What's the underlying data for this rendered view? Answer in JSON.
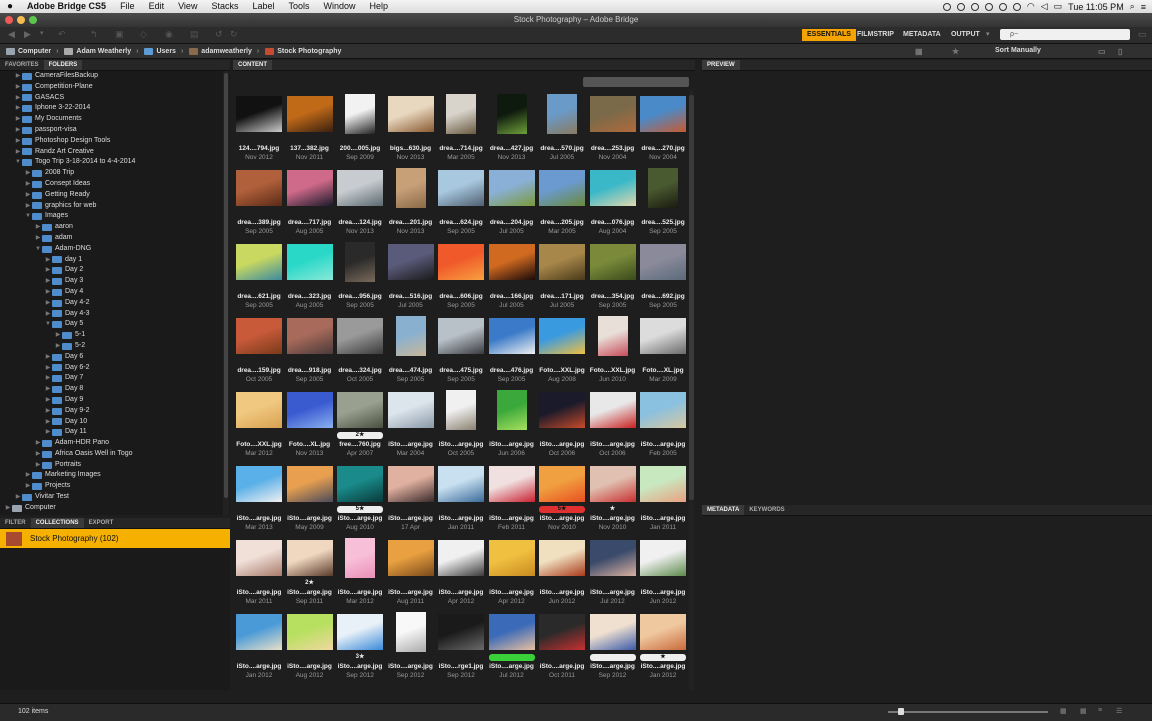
{
  "menubar": {
    "app_name": "Adobe Bridge CS5",
    "items": [
      "File",
      "Edit",
      "View",
      "Stacks",
      "Label",
      "Tools",
      "Window",
      "Help"
    ],
    "clock": "Tue 11:05 PM"
  },
  "window": {
    "title": "Stock Photography – Adobe Bridge"
  },
  "workspaces": {
    "essentials": "ESSENTIALS",
    "filmstrip": "FILMSTRIP",
    "metadata": "METADATA",
    "output": "OUTPUT"
  },
  "sort": {
    "label": "Sort Manually"
  },
  "search": {
    "placeholder": "ρ−"
  },
  "breadcrumb": [
    "Computer",
    "Adam Weatherly",
    "Users",
    "adamweatherly",
    "Stock Photography"
  ],
  "left_tabs": {
    "favorites": "FAVORITES",
    "folders": "FOLDERS"
  },
  "folders": [
    {
      "label": "CameraFilesBackup",
      "depth": 1,
      "expanded": false
    },
    {
      "label": "Competition-Plane",
      "depth": 1,
      "expanded": false
    },
    {
      "label": "GASACS",
      "depth": 1,
      "expanded": false
    },
    {
      "label": "Iphone 3-22-2014",
      "depth": 1,
      "expanded": false
    },
    {
      "label": "My Documents",
      "depth": 1,
      "expanded": false
    },
    {
      "label": "passport-visa",
      "depth": 1,
      "expanded": false
    },
    {
      "label": "Photoshop Design Tools",
      "depth": 1,
      "expanded": false
    },
    {
      "label": "Randz Art Creative",
      "depth": 1,
      "expanded": false
    },
    {
      "label": "Togo Trip 3-18-2014 to 4-4-2014",
      "depth": 1,
      "expanded": true
    },
    {
      "label": "2008 Trip",
      "depth": 2,
      "expanded": false
    },
    {
      "label": "Consept Ideas",
      "depth": 2,
      "expanded": false
    },
    {
      "label": "Getting Ready",
      "depth": 2,
      "expanded": false
    },
    {
      "label": "graphics for web",
      "depth": 2,
      "expanded": false
    },
    {
      "label": "Images",
      "depth": 2,
      "expanded": true
    },
    {
      "label": "aaron",
      "depth": 3,
      "expanded": false
    },
    {
      "label": "adam",
      "depth": 3,
      "expanded": false
    },
    {
      "label": "Adam-DNG",
      "depth": 3,
      "expanded": true
    },
    {
      "label": "day 1",
      "depth": 4,
      "expanded": false
    },
    {
      "label": "Day 2",
      "depth": 4,
      "expanded": false
    },
    {
      "label": "Day 3",
      "depth": 4,
      "expanded": false
    },
    {
      "label": "Day 4",
      "depth": 4,
      "expanded": false
    },
    {
      "label": "Day 4-2",
      "depth": 4,
      "expanded": false
    },
    {
      "label": "Day 4-3",
      "depth": 4,
      "expanded": false
    },
    {
      "label": "Day 5",
      "depth": 4,
      "expanded": true
    },
    {
      "label": "5-1",
      "depth": 5,
      "expanded": false
    },
    {
      "label": "5-2",
      "depth": 5,
      "expanded": false
    },
    {
      "label": "Day 6",
      "depth": 4,
      "expanded": false
    },
    {
      "label": "Day 6-2",
      "depth": 4,
      "expanded": false
    },
    {
      "label": "Day 7",
      "depth": 4,
      "expanded": false
    },
    {
      "label": "Day 8",
      "depth": 4,
      "expanded": false
    },
    {
      "label": "Day 9",
      "depth": 4,
      "expanded": false
    },
    {
      "label": "Day 9-2",
      "depth": 4,
      "expanded": false
    },
    {
      "label": "Day 10",
      "depth": 4,
      "expanded": false
    },
    {
      "label": "Day 11",
      "depth": 4,
      "expanded": false
    },
    {
      "label": "Adam-HDR Pano",
      "depth": 3,
      "expanded": false
    },
    {
      "label": "Africa Oasis Well in Togo",
      "depth": 3,
      "expanded": false
    },
    {
      "label": "Portraits",
      "depth": 3,
      "expanded": false
    },
    {
      "label": "Marketing Images",
      "depth": 2,
      "expanded": false
    },
    {
      "label": "Projects",
      "depth": 2,
      "expanded": false
    },
    {
      "label": "Vivitar Test",
      "depth": 1,
      "expanded": false
    },
    {
      "label": "Computer",
      "depth": 0,
      "expanded": false
    }
  ],
  "bottom_tabs": {
    "filter": "FILTER",
    "collections": "COLLECTIONS",
    "export": "EXPORT"
  },
  "collection": {
    "label": "Stock Photography (102)"
  },
  "content_tab": "CONTENT",
  "preview_tab": "PREVIEW",
  "meta_tabs": {
    "metadata": "METADATA",
    "keywords": "KEYWORDS"
  },
  "status": {
    "items": "102 items"
  },
  "thumbnails": [
    {
      "name": "124....794.jpg",
      "date": "Nov 2012",
      "c1": "#111111",
      "c2": "#cccccc",
      "rating": ""
    },
    {
      "name": "137...382.jpg",
      "date": "Nov 2011",
      "c1": "#c06a18",
      "c2": "#3a2010",
      "rating": ""
    },
    {
      "name": "200....005.jpg",
      "date": "Sep 2009",
      "c1": "#f2f2f2",
      "c2": "#222222",
      "rating": "",
      "tall": true
    },
    {
      "name": "bigs...630.jpg",
      "date": "Nov 2013",
      "c1": "#e8d8c0",
      "c2": "#8a5a30",
      "rating": ""
    },
    {
      "name": "drea....714.jpg",
      "date": "Mar 2005",
      "c1": "#d8d4cc",
      "c2": "#6a5a40",
      "rating": "",
      "tall": true
    },
    {
      "name": "drea....427.jpg",
      "date": "Nov 2013",
      "c1": "#0e1a0e",
      "c2": "#6ea03a",
      "rating": "",
      "tall": true
    },
    {
      "name": "drea....570.jpg",
      "date": "Jul 2005",
      "c1": "#6a9ac8",
      "c2": "#8a7a60",
      "rating": "",
      "tall": true
    },
    {
      "name": "drea....253.jpg",
      "date": "Nov 2004",
      "c1": "#7a6a4a",
      "c2": "#b06a3a",
      "rating": ""
    },
    {
      "name": "drea....270.jpg",
      "date": "Nov 2004",
      "c1": "#4a8ac8",
      "c2": "#c85a30",
      "rating": ""
    },
    {
      "name": "drea....389.jpg",
      "date": "Sep 2005",
      "c1": "#b0603a",
      "c2": "#5a2a18",
      "rating": ""
    },
    {
      "name": "drea....717.jpg",
      "date": "Aug 2005",
      "c1": "#d06a8a",
      "c2": "#1a1a2a",
      "rating": ""
    },
    {
      "name": "drea....124.jpg",
      "date": "Nov 2013",
      "c1": "#c8ccd0",
      "c2": "#5a6a70",
      "rating": ""
    },
    {
      "name": "drea....201.jpg",
      "date": "Nov 2013",
      "c1": "#c8a078",
      "c2": "#8a6a48",
      "rating": "",
      "tall": true
    },
    {
      "name": "drea....624.jpg",
      "date": "Sep 2005",
      "c1": "#a8c8e0",
      "c2": "#506070",
      "rating": ""
    },
    {
      "name": "drea....204.jpg",
      "date": "Jul 2005",
      "c1": "#8ab0d8",
      "c2": "#7a9a3a",
      "rating": ""
    },
    {
      "name": "drea....205.jpg",
      "date": "Mar 2005",
      "c1": "#6a9ad0",
      "c2": "#6a8a3a",
      "rating": ""
    },
    {
      "name": "drea....076.jpg",
      "date": "Aug 2004",
      "c1": "#3ab8c8",
      "c2": "#e0d8b0",
      "rating": ""
    },
    {
      "name": "drea....525.jpg",
      "date": "Sep 2005",
      "c1": "#4a5a30",
      "c2": "#1a1a10",
      "rating": "",
      "tall": true
    },
    {
      "name": "drea....621.jpg",
      "date": "Sep 2005",
      "c1": "#c8d860",
      "c2": "#3a8aa0",
      "rating": ""
    },
    {
      "name": "drea....323.jpg",
      "date": "Aug 2005",
      "c1": "#2ad8c8",
      "c2": "#8ae8d8",
      "rating": ""
    },
    {
      "name": "drea....956.jpg",
      "date": "Sep 2005",
      "c1": "#2a2a2a",
      "c2": "#7a6a5a",
      "rating": "",
      "tall": true
    },
    {
      "name": "drea....516.jpg",
      "date": "Jul 2005",
      "c1": "#5a5a7a",
      "c2": "#1a1a1a",
      "rating": ""
    },
    {
      "name": "drea....606.jpg",
      "date": "Sep 2005",
      "c1": "#f05a2a",
      "c2": "#f8a040",
      "rating": ""
    },
    {
      "name": "drea....166.jpg",
      "date": "Jul 2005",
      "c1": "#d06a20",
      "c2": "#1a0a0a",
      "rating": ""
    },
    {
      "name": "drea....171.jpg",
      "date": "Jul 2005",
      "c1": "#a8884a",
      "c2": "#4a3a1a",
      "rating": ""
    },
    {
      "name": "drea....354.jpg",
      "date": "Sep 2005",
      "c1": "#7a8a3a",
      "c2": "#3a4a1a",
      "rating": ""
    },
    {
      "name": "drea....692.jpg",
      "date": "Sep 2005",
      "c1": "#8a8a9a",
      "c2": "#5a6a7a",
      "rating": ""
    },
    {
      "name": "drea....159.jpg",
      "date": "Oct 2005",
      "c1": "#c85a3a",
      "c2": "#7a3a1a",
      "rating": ""
    },
    {
      "name": "drea....918.jpg",
      "date": "Sep 2005",
      "c1": "#a86a5a",
      "c2": "#4a3a3a",
      "rating": ""
    },
    {
      "name": "drea....324.jpg",
      "date": "Oct 2005",
      "c1": "#9a9a9a",
      "c2": "#3a3a3a",
      "rating": ""
    },
    {
      "name": "drea....474.jpg",
      "date": "Sep 2005",
      "c1": "#8ab0d0",
      "c2": "#c8b898",
      "rating": "",
      "tall": true
    },
    {
      "name": "drea....475.jpg",
      "date": "Sep 2005",
      "c1": "#b8c0c8",
      "c2": "#3a3a40",
      "rating": ""
    },
    {
      "name": "drea....476.jpg",
      "date": "Sep 2005",
      "c1": "#3a7ac8",
      "c2": "#f0f0f0",
      "rating": ""
    },
    {
      "name": "Foto....XXL.jpg",
      "date": "Aug 2008",
      "c1": "#3a9ae0",
      "c2": "#f0c040",
      "rating": ""
    },
    {
      "name": "Foto....XXL.jpg",
      "date": "Jun 2010",
      "c1": "#e8e0d8",
      "c2": "#c84a5a",
      "rating": "",
      "tall": true
    },
    {
      "name": "Foto....XL.jpg",
      "date": "Mar 2009",
      "c1": "#dcdcdc",
      "c2": "#6a6a6a",
      "rating": ""
    },
    {
      "name": "Foto....XXL.jpg",
      "date": "Mar 2012",
      "c1": "#f0c880",
      "c2": "#d8a050",
      "rating": ""
    },
    {
      "name": "Foto....XL.jpg",
      "date": "Nov 2013",
      "c1": "#3a5ad0",
      "c2": "#8ab0f0",
      "rating": ""
    },
    {
      "name": "free....760.jpg",
      "date": "Apr 2007",
      "c1": "#9aa090",
      "c2": "#4a5040",
      "rating": "2★"
    },
    {
      "name": "iSto....arge.jpg",
      "date": "Mar 2004",
      "c1": "#dce4ec",
      "c2": "#8a9aa8",
      "rating": ""
    },
    {
      "name": "iSto....arge.jpg",
      "date": "Oct 2005",
      "c1": "#f0f0f0",
      "c2": "#8a8070",
      "rating": "",
      "tall": true
    },
    {
      "name": "iSto....arge.jpg",
      "date": "Jun 2006",
      "c1": "#3aa83a",
      "c2": "#a8e060",
      "rating": "",
      "tall": true
    },
    {
      "name": "iSto....arge.jpg",
      "date": "Oct 2006",
      "c1": "#1a1a2a",
      "c2": "#c84a2a",
      "rating": ""
    },
    {
      "name": "iSto....arge.jpg",
      "date": "Oct 2006",
      "c1": "#e8e8e8",
      "c2": "#c82020",
      "rating": ""
    },
    {
      "name": "iSto....arge.jpg",
      "date": "Feb 2005",
      "c1": "#8ac0e0",
      "c2": "#d8c8a0",
      "rating": ""
    },
    {
      "name": "iSto....arge.jpg",
      "date": "Mar 2013",
      "c1": "#5ab0e8",
      "c2": "#f0f0f0",
      "rating": ""
    },
    {
      "name": "iSto....arge.jpg",
      "date": "May 2009",
      "c1": "#e8a050",
      "c2": "#4a4a5a",
      "rating": ""
    },
    {
      "name": "iSto....arge.jpg",
      "date": "Aug 2010",
      "c1": "#1a8a8a",
      "c2": "#0a3a3a",
      "rating": "5★"
    },
    {
      "name": "iSto....arge.jpg",
      "date": "17 Apr",
      "c1": "#e0b0a0",
      "c2": "#3a2a2a",
      "rating": ""
    },
    {
      "name": "iSto....arge.jpg",
      "date": "Jan 2011",
      "c1": "#c8e0f0",
      "c2": "#3a6a9a",
      "rating": ""
    },
    {
      "name": "iSto....arge.jpg",
      "date": "Feb 2011",
      "c1": "#f0e0e0",
      "c2": "#c82030",
      "rating": ""
    },
    {
      "name": "iSto....arge.jpg",
      "date": "Nov 2010",
      "c1": "#f0a040",
      "c2": "#e85020",
      "rating": "5★",
      "rcolor": "#e03030"
    },
    {
      "name": "iSto....arge.jpg",
      "date": "Nov 2010",
      "c1": "#e0c0b0",
      "c2": "#c83030",
      "rating": "★",
      "rcolor": "none"
    },
    {
      "name": "iSto....arge.jpg",
      "date": "Jan 2011",
      "c1": "#c8e8c0",
      "c2": "#e8a080",
      "rating": ""
    },
    {
      "name": "iSto....arge.jpg",
      "date": "Mar 2011",
      "c1": "#f0e0d8",
      "c2": "#a87a6a",
      "rating": ""
    },
    {
      "name": "iSto....arge.jpg",
      "date": "Sep 2011",
      "c1": "#f0d8c0",
      "c2": "#5a3a2a",
      "rating": "2★",
      "rcolor": "none"
    },
    {
      "name": "iSto....arge.jpg",
      "date": "Mar 2012",
      "c1": "#f8c0d8",
      "c2": "#e890b8",
      "rating": "",
      "tall": true
    },
    {
      "name": "iSto....arge.jpg",
      "date": "Aug 2011",
      "c1": "#e8a040",
      "c2": "#7a4a1a",
      "rating": ""
    },
    {
      "name": "iSto....arge.jpg",
      "date": "Apr 2012",
      "c1": "#f0f0f0",
      "c2": "#3a3a3a",
      "rating": ""
    },
    {
      "name": "iSto....arge.jpg",
      "date": "Apr 2012",
      "c1": "#f0c040",
      "c2": "#c88a20",
      "rating": ""
    },
    {
      "name": "iSto....arge.jpg",
      "date": "Jun 2012",
      "c1": "#f0e0c0",
      "c2": "#a83a1a",
      "rating": ""
    },
    {
      "name": "iSto....arge.jpg",
      "date": "Jul 2012",
      "c1": "#3a4a6a",
      "c2": "#d8b0a0",
      "rating": ""
    },
    {
      "name": "iSto....arge.jpg",
      "date": "Jun 2012",
      "c1": "#f0f0f0",
      "c2": "#5a8a4a",
      "rating": ""
    },
    {
      "name": "iSto....arge.jpg",
      "date": "Jan 2012",
      "c1": "#4a9ad8",
      "c2": "#e8e0c8",
      "rating": ""
    },
    {
      "name": "iSto....arge.jpg",
      "date": "Aug 2012",
      "c1": "#b8e060",
      "c2": "#f0d8a0",
      "rating": ""
    },
    {
      "name": "iSto....arge.jpg",
      "date": "Sep 2012",
      "c1": "#e8f0f8",
      "c2": "#3a8ad8",
      "rating": "3★",
      "rcolor": "none"
    },
    {
      "name": "iSto....arge.jpg",
      "date": "Sep 2012",
      "c1": "#f8f8f8",
      "c2": "#aaaaaa",
      "rating": "",
      "tall": true
    },
    {
      "name": "iSto....rge1.jpg",
      "date": "Sep 2012",
      "c1": "#1a1a1a",
      "c2": "#6a6a6a",
      "rating": ""
    },
    {
      "name": "iSto....arge.jpg",
      "date": "Jul 2012",
      "c1": "#3a6ab8",
      "c2": "#e8c0a0",
      "rating": "",
      "rcolor": "#3ad03a",
      "bar": true
    },
    {
      "name": "iSto....arge.jpg",
      "date": "Oct 2011",
      "c1": "#2a2a2a",
      "c2": "#c83030",
      "rating": ""
    },
    {
      "name": "iSto....arge.jpg",
      "date": "Sep 2012",
      "c1": "#f0e0d0",
      "c2": "#3a5aa8",
      "rating": "",
      "bar": true
    },
    {
      "name": "iSto....arge.jpg",
      "date": "Jan 2012",
      "c1": "#f0c8a0",
      "c2": "#c86a3a",
      "rating": "★"
    }
  ]
}
